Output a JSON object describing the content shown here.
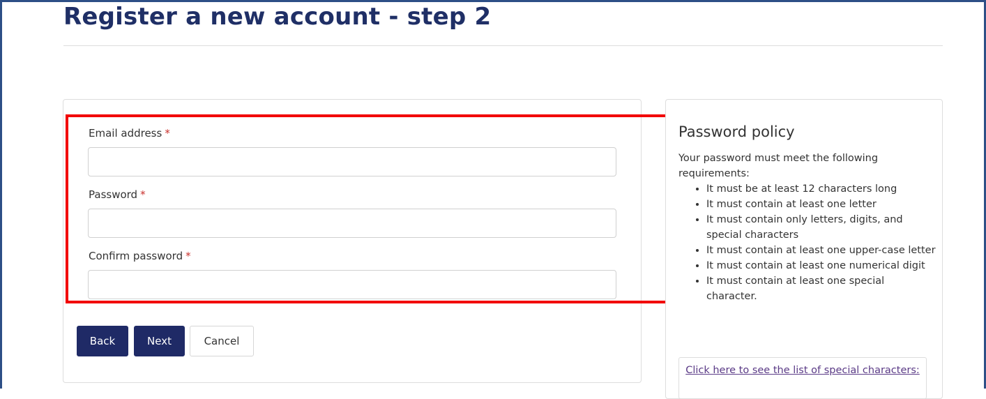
{
  "page": {
    "title": "Register a new account - step 2"
  },
  "form": {
    "email_label": "Email address",
    "password_label": "Password",
    "confirm_label": "Confirm password",
    "required_marker": "*",
    "email_value": "",
    "password_value": "",
    "confirm_value": ""
  },
  "buttons": {
    "back": "Back",
    "next": "Next",
    "cancel": "Cancel"
  },
  "policy": {
    "title": "Password policy",
    "intro": "Your password must meet the following requirements:",
    "rules": [
      "It must be at least 12 characters long",
      "It must contain at least one letter",
      "It must contain only letters, digits, and special characters",
      "It must contain at least one upper-case letter",
      "It must contain at least one numerical digit",
      "It must contain at least one special character."
    ],
    "special_link": "Click here to see the list of special characters:"
  },
  "colors": {
    "heading": "#1f2f66",
    "primary_button": "#1f2a66",
    "required": "#c9302c",
    "highlight": "#f20000",
    "frame": "#2d4f86",
    "link": "#5a3a86"
  }
}
